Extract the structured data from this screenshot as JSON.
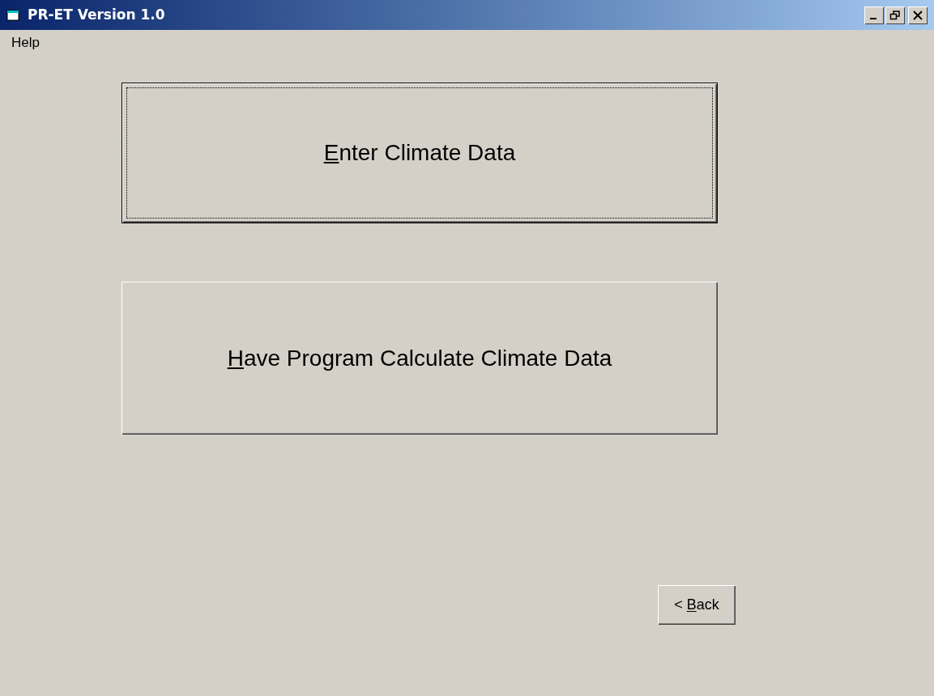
{
  "window": {
    "title": "PR-ET Version 1.0"
  },
  "menu": [
    {
      "label": "Help"
    }
  ],
  "buttons": [
    {
      "key": "E",
      "after": "nter Climate Data",
      "focused": true
    },
    {
      "key": "H",
      "after": "ave Program Calculate Climate Data",
      "focused": false
    }
  ],
  "back_button": {
    "before": "< ",
    "key": "B",
    "after": "ack",
    "focused": false
  }
}
